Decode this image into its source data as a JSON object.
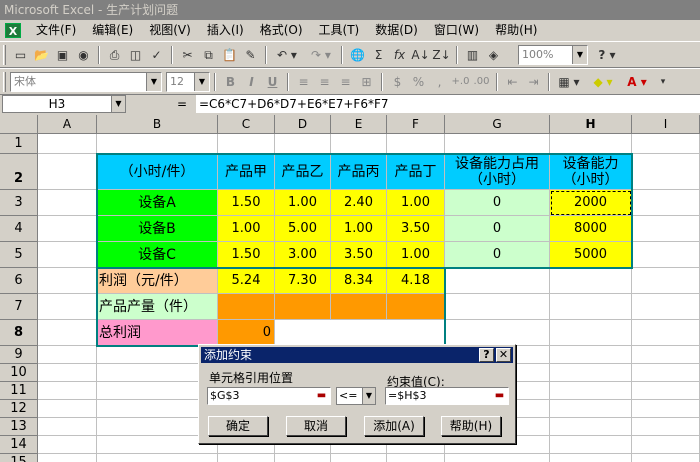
{
  "window": {
    "title": "Microsoft Excel - 生产计划问题"
  },
  "menu": {
    "items": [
      "文件(F)",
      "编辑(E)",
      "视图(V)",
      "插入(I)",
      "格式(O)",
      "工具(T)",
      "数据(D)",
      "窗口(W)",
      "帮助(H)"
    ]
  },
  "toolbar": {
    "zoom": "100%",
    "font": "宋体",
    "size": "12",
    "bold": "B",
    "italic": "I",
    "underline": "U",
    "percent": "%",
    "comma": ",",
    "sigma": "Σ",
    "fx": "fx"
  },
  "formula_bar": {
    "name_box": "H3",
    "equals": "=",
    "formula": "=C6*C7+D6*D7+E6*E7+F6*F7"
  },
  "columns": [
    "A",
    "B",
    "C",
    "D",
    "E",
    "F",
    "G",
    "H",
    "I"
  ],
  "rows": [
    "1",
    "2",
    "3",
    "4",
    "5",
    "6",
    "7",
    "8",
    "9",
    "10",
    "11",
    "12",
    "13",
    "14",
    "15"
  ],
  "sheet": {
    "header": {
      "b": "（小时/件）",
      "c": "产品甲",
      "d": "产品乙",
      "e": "产品丙",
      "f": "产品丁",
      "g": "设备能力占用（小时）",
      "h": "设备能力（小时）"
    },
    "devices": [
      {
        "name": "设备A",
        "c": "1.50",
        "d": "1.00",
        "e": "2.40",
        "f": "1.00",
        "g": "0",
        "h": "2000"
      },
      {
        "name": "设备B",
        "c": "1.00",
        "d": "5.00",
        "e": "1.00",
        "f": "3.50",
        "g": "0",
        "h": "8000"
      },
      {
        "name": "设备C",
        "c": "1.50",
        "d": "3.00",
        "e": "3.50",
        "f": "1.00",
        "g": "0",
        "h": "5000"
      }
    ],
    "profit": {
      "label": "利润（元/件）",
      "c": "5.24",
      "d": "7.30",
      "e": "8.34",
      "f": "4.18"
    },
    "output": {
      "label": "产品产量（件）"
    },
    "total": {
      "label": "总利润",
      "value": "0"
    }
  },
  "dialog": {
    "title": "添加约束",
    "help_btn": "?",
    "close_btn": "✕",
    "cell_ref_label": "单元格引用位置",
    "cell_ref_value": "$G$3",
    "operator": "<=",
    "constraint_label": "约束值(C):",
    "constraint_value": "=$H$3",
    "buttons": {
      "ok": "确定",
      "cancel": "取消",
      "add": "添加(A)",
      "help": "帮助(H)"
    }
  },
  "colors": {
    "cyan": "#00ccff",
    "green": "#00ff00",
    "yellow": "#ffff00",
    "light_green": "#ccffcc",
    "peach": "#ffcc99",
    "orange": "#ff9900",
    "pink": "#ff99cc",
    "teal_border": "#008080",
    "title_blue": "#0a246a"
  }
}
